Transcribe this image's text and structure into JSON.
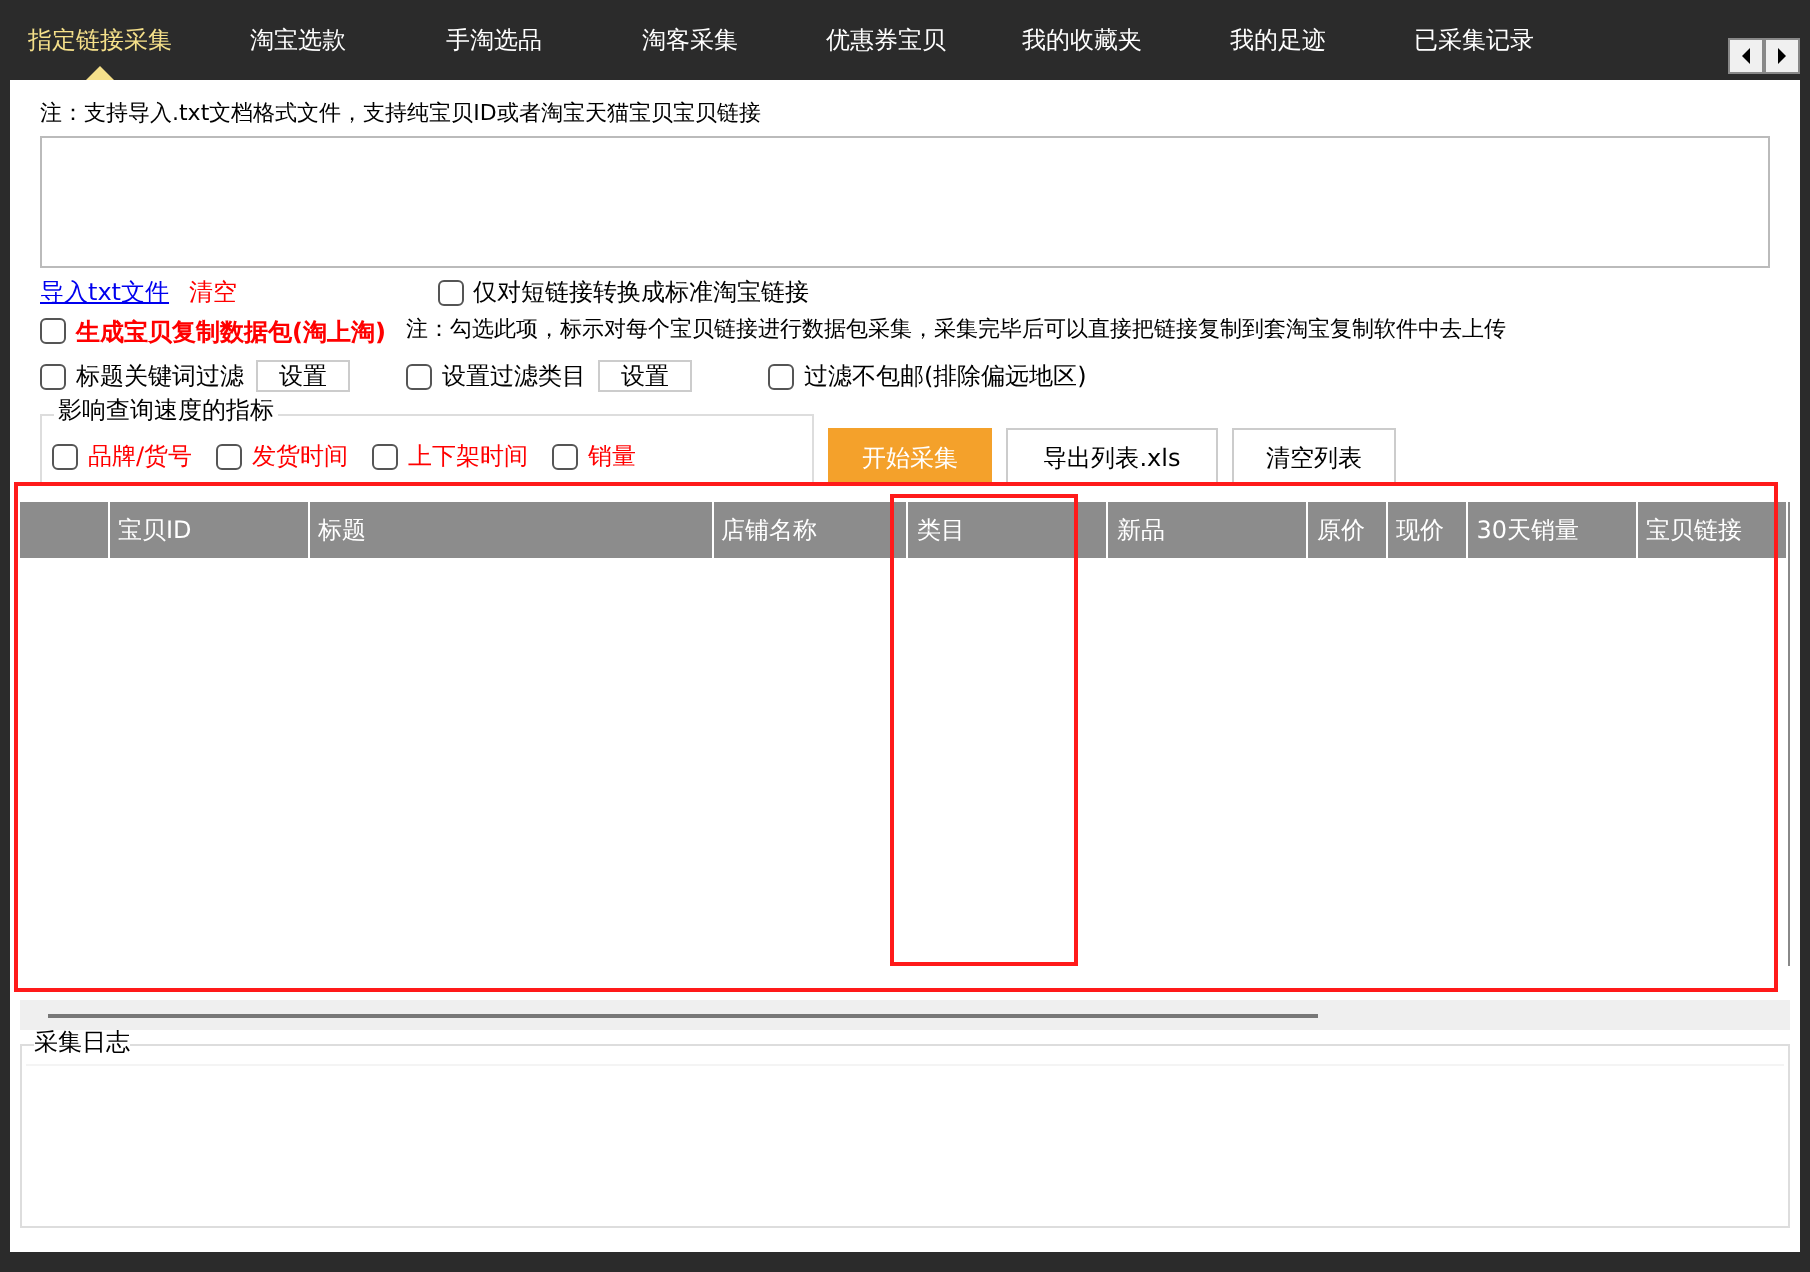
{
  "tabs": [
    {
      "label": "指定链接采集",
      "selected": true
    },
    {
      "label": "淘宝选款",
      "selected": false
    },
    {
      "label": "手淘选品",
      "selected": false
    },
    {
      "label": "淘客采集",
      "selected": false
    },
    {
      "label": "优惠券宝贝",
      "selected": false
    },
    {
      "label": "我的收藏夹",
      "selected": false
    },
    {
      "label": "我的足迹",
      "selected": false
    },
    {
      "label": "已采集记录",
      "selected": false
    }
  ],
  "note": "注：支持导入.txt文档格式文件，支持纯宝贝ID或者淘宝天猫宝贝宝贝链接",
  "import_link": "导入txt文件",
  "clear_link": "清空",
  "short_link_option": {
    "label": "仅对短链接转换成标准淘宝链接",
    "checked": false
  },
  "package_option": {
    "label": "生成宝贝复制数据包(淘上淘)",
    "checked": false,
    "hint": "注：勾选此项，标示对每个宝贝链接进行数据包采集，采集完毕后可以直接把链接复制到套淘宝复制软件中去上传"
  },
  "filters": [
    {
      "label": "标题关键词过滤",
      "checked": false,
      "button": "设置"
    },
    {
      "label": "设置过滤类目",
      "checked": false,
      "button": "设置"
    },
    {
      "label": "过滤不包邮(排除偏远地区)",
      "checked": false
    }
  ],
  "speed_group": {
    "title": "影响查询速度的指标",
    "options": [
      {
        "label": "品牌/货号",
        "checked": false
      },
      {
        "label": "发货时间",
        "checked": false
      },
      {
        "label": "上下架时间",
        "checked": false
      },
      {
        "label": "销量",
        "checked": false
      }
    ]
  },
  "buttons": [
    {
      "label": "开始采集",
      "kind": "primary"
    },
    {
      "label": "导出列表.xls",
      "kind": "normal"
    },
    {
      "label": "清空列表",
      "kind": "normal"
    }
  ],
  "table": {
    "columns": [
      "",
      "宝贝ID",
      "标题",
      "店铺名称",
      "类目",
      "新品",
      "原价",
      "现价",
      "30天销量",
      "宝贝链接"
    ]
  },
  "log": {
    "title": "采集日志"
  }
}
